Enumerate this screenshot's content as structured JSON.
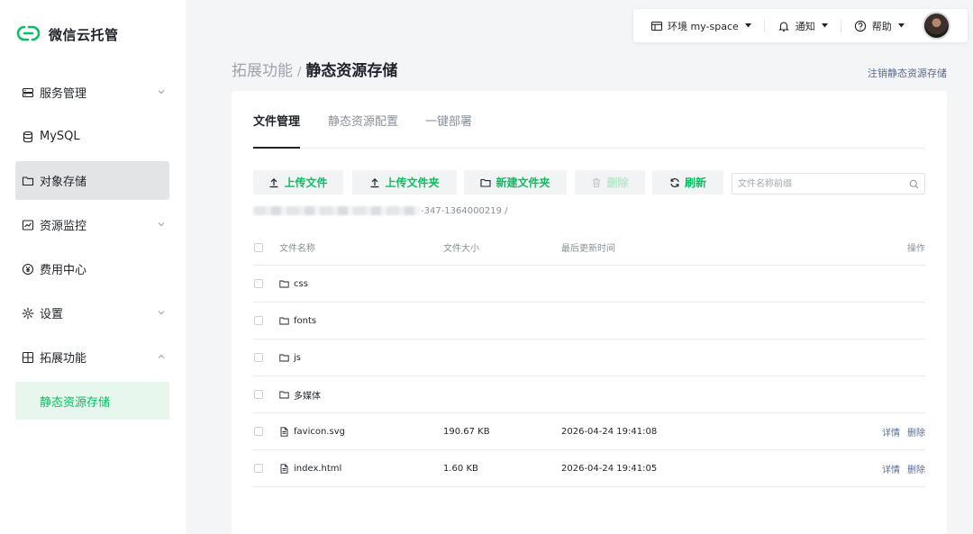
{
  "brand": {
    "name": "微信云托管",
    "color": "#07c160"
  },
  "sidebar": {
    "items": [
      {
        "label": "服务管理",
        "icon": "server-icon",
        "chevron": "down"
      },
      {
        "label": "MySQL",
        "icon": "database-icon",
        "chevron": ""
      },
      {
        "label": "对象存储",
        "icon": "folder-icon",
        "chevron": "",
        "active": true
      },
      {
        "label": "资源监控",
        "icon": "chart-icon",
        "chevron": "down"
      },
      {
        "label": "费用中心",
        "icon": "yuan-icon",
        "chevron": ""
      },
      {
        "label": "设置",
        "icon": "gear-icon",
        "chevron": "down"
      },
      {
        "label": "拓展功能",
        "icon": "grid-icon",
        "chevron": "up"
      }
    ],
    "subitem": {
      "label": "静态资源存储"
    }
  },
  "topbar": {
    "env_label": "环境 my-space",
    "notify_label": "通知",
    "help_label": "帮助"
  },
  "header": {
    "parent": "拓展功能",
    "separator": "/",
    "title": "静态资源存储",
    "cancel_link": "注销静态资源存储"
  },
  "tabs": [
    {
      "label": "文件管理",
      "active": true
    },
    {
      "label": "静态资源配置"
    },
    {
      "label": "一键部署"
    }
  ],
  "toolbar": {
    "upload_file": "上传文件",
    "upload_folder": "上传文件夹",
    "new_folder": "新建文件夹",
    "delete": "删除",
    "refresh": "刷新",
    "search_placeholder": "文件名称前缀"
  },
  "path": {
    "visible_text": "-347-1364000219 /"
  },
  "table": {
    "columns": [
      "文件名称",
      "文件大小",
      "最后更新时间",
      "操作"
    ],
    "rows": [
      {
        "type": "folder",
        "name": "css",
        "size": "",
        "time": ""
      },
      {
        "type": "folder",
        "name": "fonts",
        "size": "",
        "time": ""
      },
      {
        "type": "folder",
        "name": "js",
        "size": "",
        "time": ""
      },
      {
        "type": "folder",
        "name": "多媒体",
        "size": "",
        "time": ""
      },
      {
        "type": "file",
        "name": "favicon.svg",
        "size": "190.67 KB",
        "time": "2026-04-24 19:41:08",
        "op_detail": "详情",
        "op_delete": "删除"
      },
      {
        "type": "file",
        "name": "index.html",
        "size": "1.60 KB",
        "time": "2026-04-24 19:41:05",
        "op_detail": "详情",
        "op_delete": "删除"
      }
    ]
  },
  "colors": {
    "accent": "#07c160",
    "link": "#576b95",
    "active_nav_bg": "#e3e4e6",
    "sub_nav_bg": "#e7f7ed"
  }
}
